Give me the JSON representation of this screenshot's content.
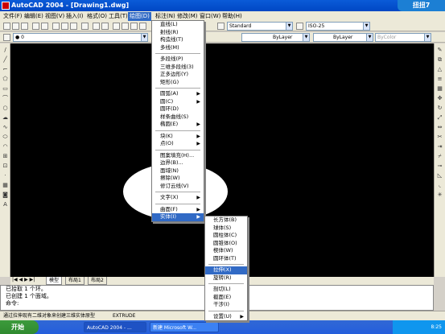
{
  "window": {
    "title": "AutoCAD 2004 - [Drawing1.dwg]",
    "badge": "扭扭7"
  },
  "menubar": [
    "文件(F)",
    "编辑(E)",
    "视图(V)",
    "插入(I)",
    "格式(O)",
    "工具(T)",
    "绘图(D)",
    "标注(N)",
    "修改(M)",
    "窗口(W)",
    "帮助(H)"
  ],
  "toolbar": {
    "text_style": "Standard",
    "dim_style": "ISO-25",
    "layer": "0",
    "color": "ByLayer",
    "linetype": "ByLayer",
    "lineweight": "ByColor"
  },
  "draw_menu": {
    "items": [
      {
        "label": "直线(L)"
      },
      {
        "label": "射线(R)"
      },
      {
        "label": "构造线(T)"
      },
      {
        "label": "多线(M)"
      },
      {
        "sep": true
      },
      {
        "label": "多段线(P)"
      },
      {
        "label": "三维多段线(3)"
      },
      {
        "label": "正多边形(Y)"
      },
      {
        "label": "矩形(G)"
      },
      {
        "sep": true
      },
      {
        "label": "圆弧(A)",
        "sub": "▶"
      },
      {
        "label": "圆(C)",
        "sub": "▶"
      },
      {
        "label": "圆环(D)"
      },
      {
        "label": "样条曲线(S)"
      },
      {
        "label": "椭圆(E)",
        "sub": "▶"
      },
      {
        "sep": true
      },
      {
        "label": "块(K)",
        "sub": "▶"
      },
      {
        "label": "点(O)",
        "sub": "▶"
      },
      {
        "sep": true
      },
      {
        "label": "图案填充(H)..."
      },
      {
        "label": "边界(B)..."
      },
      {
        "label": "面域(N)"
      },
      {
        "label": "擦除(W)"
      },
      {
        "label": "修订云线(V)"
      },
      {
        "sep": true
      },
      {
        "label": "文字(X)",
        "sub": "▶"
      },
      {
        "sep": true
      },
      {
        "label": "曲面(F)",
        "sub": "▶"
      },
      {
        "label": "实体(I)",
        "sub": "▶",
        "selected": true
      }
    ]
  },
  "solids_menu": {
    "items": [
      {
        "label": "长方体(B)"
      },
      {
        "label": "球体(S)"
      },
      {
        "label": "圆柱体(C)"
      },
      {
        "label": "圆锥体(O)"
      },
      {
        "label": "楔体(W)"
      },
      {
        "label": "圆环体(T)"
      },
      {
        "sep": true
      },
      {
        "label": "拉伸(X)",
        "selected": true
      },
      {
        "label": "旋转(R)"
      },
      {
        "sep": true
      },
      {
        "label": "剖切(L)"
      },
      {
        "label": "截面(E)"
      },
      {
        "label": "干涉(I)"
      },
      {
        "sep": true
      },
      {
        "label": "设置(U)",
        "sub": "▶"
      }
    ]
  },
  "tabs": [
    "模型",
    "布局1",
    "布局2"
  ],
  "command": {
    "lines": [
      "已拾取 1 个环。",
      "已创建 1 个面域。",
      "命令:"
    ]
  },
  "status": {
    "text": "通过拉伸现有二维对象来创建三维实体原型",
    "command": "EXTRUDE"
  },
  "taskbar": {
    "start": "开始",
    "tasks": [
      "AutoCAD 2004 - ...",
      "新建 Microsoft W..."
    ],
    "clock": "8:25"
  }
}
